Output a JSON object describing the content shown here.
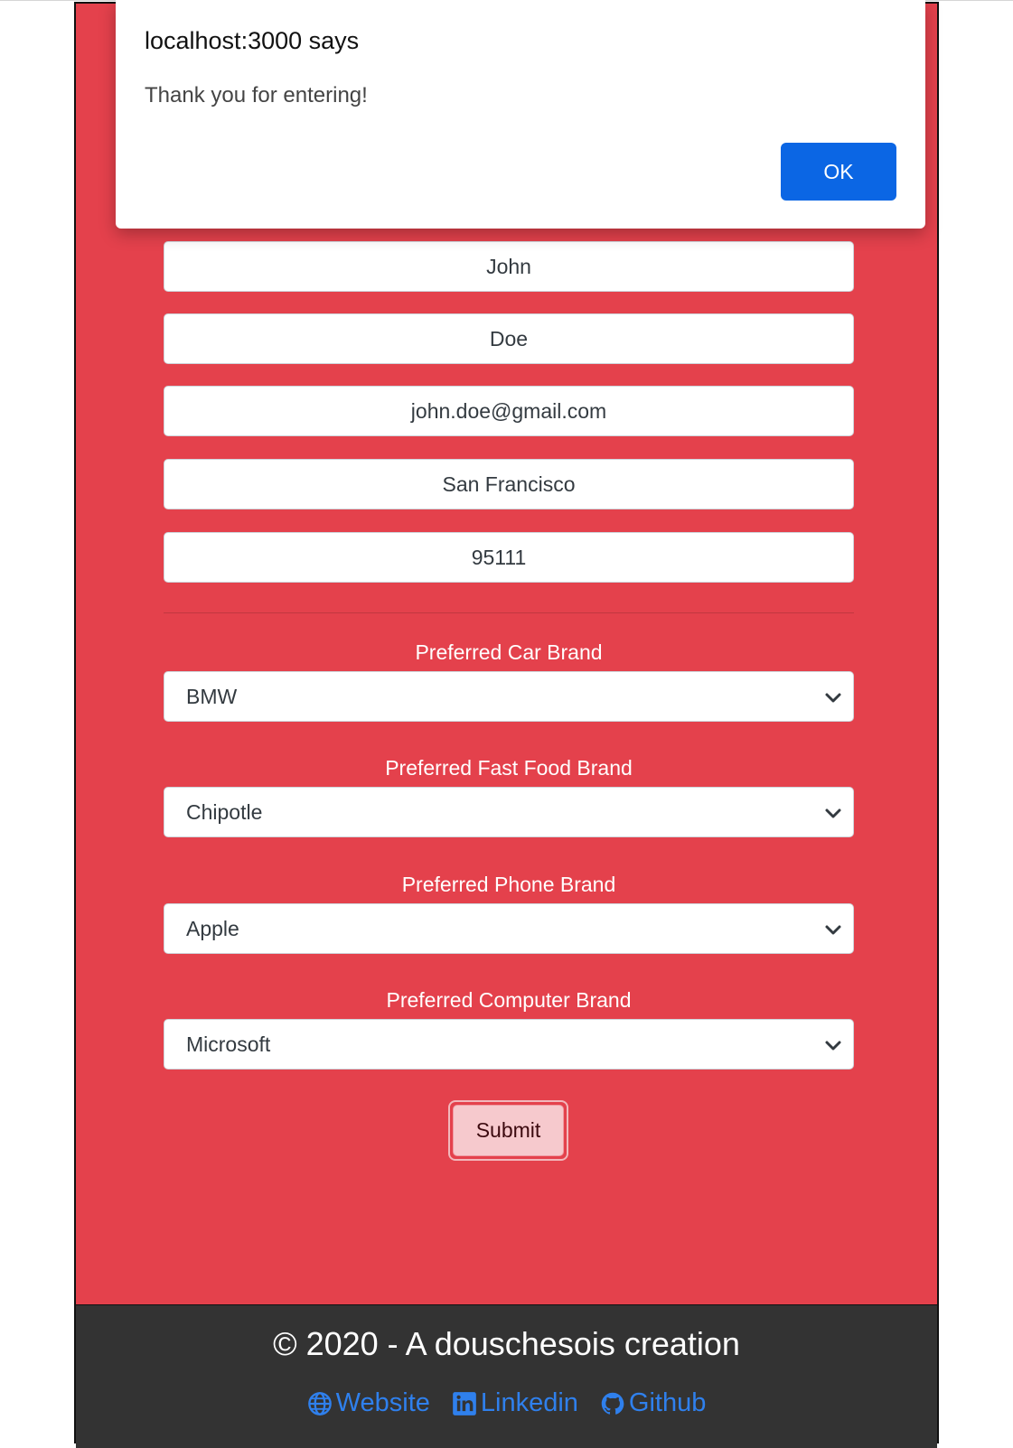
{
  "form": {
    "first_name": "John",
    "last_name": "Doe",
    "email": "john.doe@gmail.com",
    "city": "San Francisco",
    "zip": "95111",
    "car": {
      "label": "Preferred Car Brand",
      "value": "BMW"
    },
    "fast_food": {
      "label": "Preferred Fast Food Brand",
      "value": "Chipotle"
    },
    "phone": {
      "label": "Preferred Phone Brand",
      "value": "Apple"
    },
    "computer": {
      "label": "Preferred Computer Brand",
      "value": "Microsoft"
    },
    "submit_label": "Submit"
  },
  "footer": {
    "copyright": "© 2020 - A douschesois creation",
    "links": [
      {
        "label": "Website",
        "icon": "globe-icon"
      },
      {
        "label": "Linkedin",
        "icon": "linkedin-icon"
      },
      {
        "label": "Github",
        "icon": "github-icon"
      }
    ]
  },
  "dialog": {
    "title": "localhost:3000 says",
    "message": "Thank you for entering!",
    "ok_label": "OK"
  },
  "colors": {
    "page_bg": "#e4414c",
    "footer_bg": "#333333",
    "link": "#2f80ed",
    "ok_button": "#0b66e4"
  }
}
